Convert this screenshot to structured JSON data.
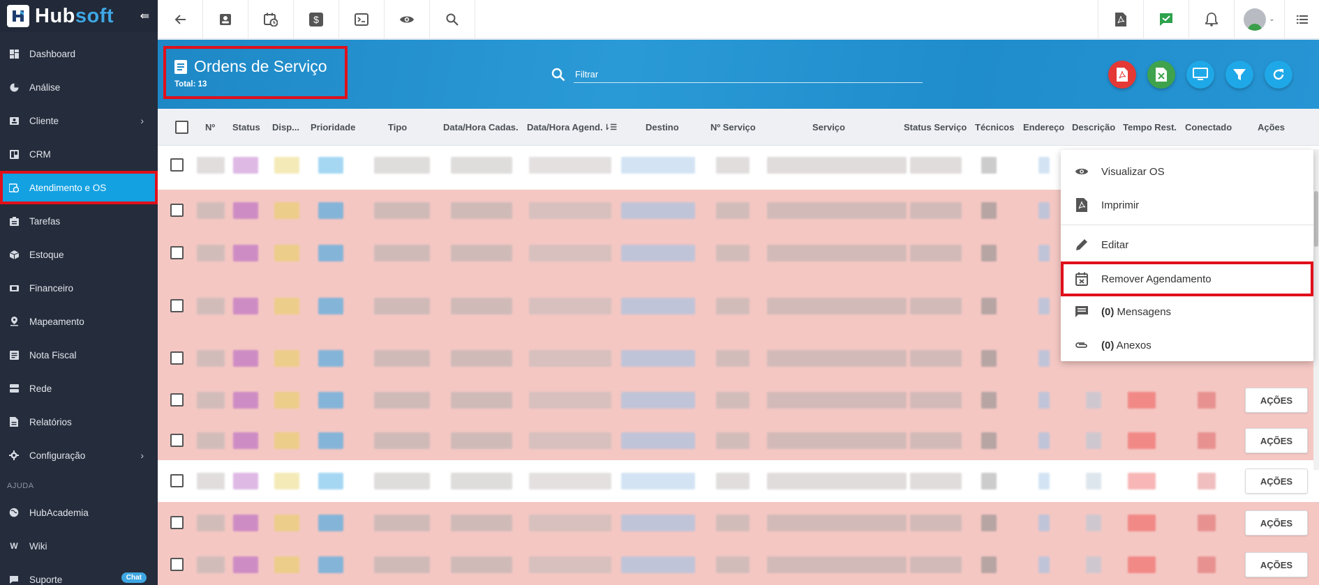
{
  "brand": {
    "name_part1": "Hub",
    "name_part2": "soft"
  },
  "sidebar": {
    "items": [
      {
        "label": "Dashboard",
        "icon": "dashboard-icon"
      },
      {
        "label": "Análise",
        "icon": "pie-chart-icon"
      },
      {
        "label": "Cliente",
        "icon": "contact-card-icon",
        "has_submenu": true
      },
      {
        "label": "CRM",
        "icon": "crm-icon"
      },
      {
        "label": "Atendimento e OS",
        "icon": "calendar-clock-icon",
        "active": true
      },
      {
        "label": "Tarefas",
        "icon": "tasks-icon"
      },
      {
        "label": "Estoque",
        "icon": "box-icon"
      },
      {
        "label": "Financeiro",
        "icon": "money-icon"
      },
      {
        "label": "Mapeamento",
        "icon": "map-pin-icon"
      },
      {
        "label": "Nota Fiscal",
        "icon": "invoice-icon"
      },
      {
        "label": "Rede",
        "icon": "server-icon"
      },
      {
        "label": "Relatórios",
        "icon": "report-icon"
      },
      {
        "label": "Configuração",
        "icon": "gear-icon",
        "has_submenu": true
      }
    ],
    "section_label": "AJUDA",
    "help_items": [
      {
        "label": "HubAcademia",
        "icon": "globe-icon"
      },
      {
        "label": "Wiki",
        "icon": "wiki-icon"
      },
      {
        "label": "Suporte",
        "icon": "chat-icon",
        "badge": "Chat"
      }
    ]
  },
  "header": {
    "title": "Ordens de Serviço",
    "total": "Total: 13",
    "filter_placeholder": "Filtrar"
  },
  "table": {
    "columns": [
      "Nº",
      "Status",
      "Disp...",
      "Prioridade",
      "Tipo",
      "Data/Hora Cadas.",
      "Data/Hora Agend.",
      "Destino",
      "Nº Serviço",
      "Serviço",
      "Status Serviço",
      "Técnicos",
      "Endereço",
      "Descrição",
      "Tempo Rest.",
      "Conectado",
      "Ações"
    ],
    "action_button_label": "AÇÕES"
  },
  "menu": {
    "items": [
      {
        "label": "Visualizar OS",
        "icon": "eye-icon"
      },
      {
        "label": "Imprimir",
        "icon": "pdf-icon"
      },
      {
        "label": "Editar",
        "icon": "pencil-icon"
      },
      {
        "label": "Remover Agendamento",
        "icon": "calendar-remove-icon"
      },
      {
        "count": "(0)",
        "label": " Mensagens",
        "icon": "message-icon"
      },
      {
        "count": "(0)",
        "label": " Anexos",
        "icon": "paperclip-icon"
      }
    ]
  },
  "colors": {
    "sidebar_bg": "#252c3b",
    "active_item": "#13a1e2",
    "header_blue": "#1e88c6",
    "highlight": "#e0101b",
    "row_red": "#f4c7c3"
  }
}
